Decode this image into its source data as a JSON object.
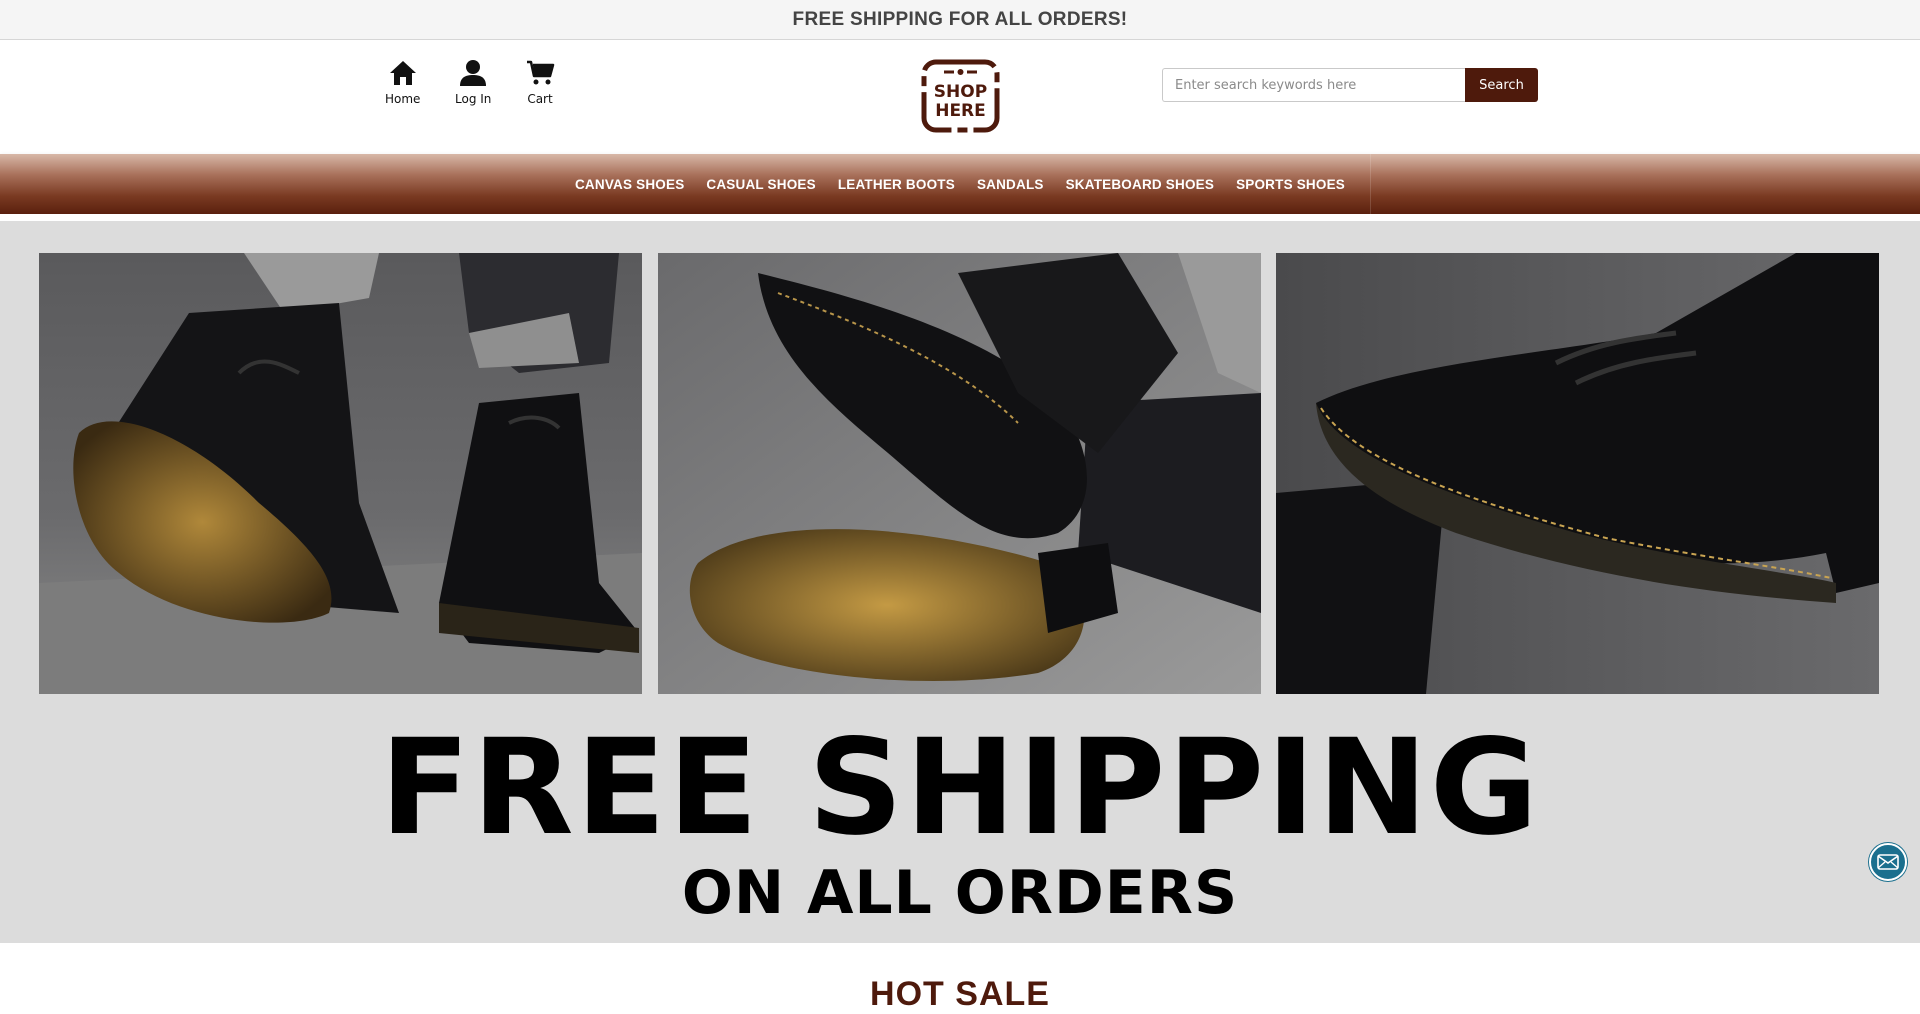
{
  "topbar": {
    "text": "FREE SHIPPING FOR ALL ORDERS!"
  },
  "header": {
    "nav": [
      {
        "label": "Home",
        "icon": "home-icon"
      },
      {
        "label": "Log In",
        "icon": "user-icon"
      },
      {
        "label": "Cart",
        "icon": "cart-icon"
      }
    ],
    "logo": {
      "line1": "SHOP",
      "line2": "HERE"
    },
    "search": {
      "placeholder": "Enter search keywords here",
      "value": "",
      "button_label": "Search"
    }
  },
  "categories": [
    "CANVAS SHOES",
    "CASUAL SHOES",
    "LEATHER BOOTS",
    "SANDALS",
    "SKATEBOARD SHOES",
    "SPORTS SHOES"
  ],
  "banner": {
    "headline": "FREE SHIPPING",
    "subheadline": "ON ALL ORDERS"
  },
  "section": {
    "title": "HOT SALE"
  },
  "contact": {
    "icon": "mail-icon"
  },
  "colors": {
    "brand": "#4e1a0c",
    "nav_gradient_top": "#d8b8a8",
    "nav_gradient_bottom": "#5a200e",
    "banner_bg": "#dcdcdc",
    "mail_button": "#1a6f8e"
  }
}
